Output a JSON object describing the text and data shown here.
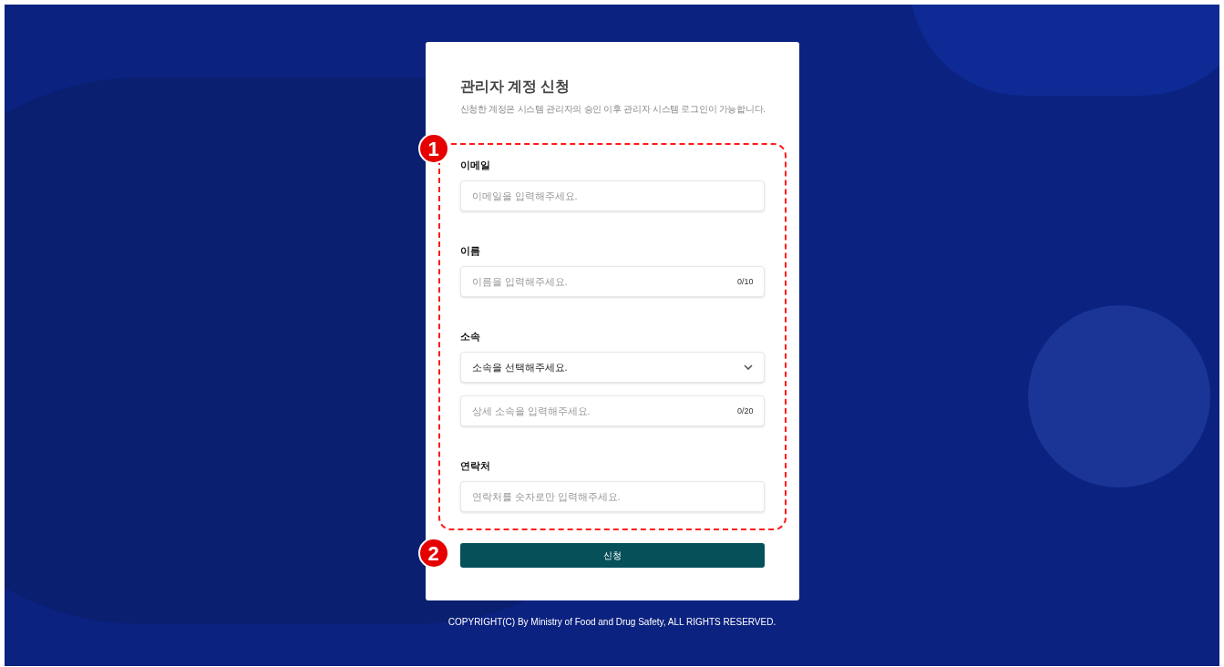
{
  "title": "관리자 계정 신청",
  "subtitle": "신청한 계정은 시스템 관리자의 승인 이후 관리자 시스템 로그인이 가능합니다.",
  "markers": [
    "1",
    "2"
  ],
  "sections": [
    {
      "label": "이메일",
      "fields": [
        {
          "kind": "text",
          "placeholder": "이메일을 입력해주세요."
        }
      ]
    },
    {
      "label": "이름",
      "fields": [
        {
          "kind": "text",
          "placeholder": "이름을 입력해주세요.",
          "counter": "0/10"
        }
      ]
    },
    {
      "label": "소속",
      "fields": [
        {
          "kind": "select",
          "value": "소속을 선택해주세요."
        },
        {
          "kind": "text",
          "placeholder": "상세 소속을 입력해주세요.",
          "counter": "0/20"
        }
      ]
    },
    {
      "label": "연락처",
      "fields": [
        {
          "kind": "text",
          "placeholder": "연락처를 숫자로만 입력해주세요."
        }
      ]
    }
  ],
  "submit_button": "신청",
  "footer": "COPYRIGHT(C) By Ministry of Food and Drug Safety, ALL RIGHTS RESERVED."
}
